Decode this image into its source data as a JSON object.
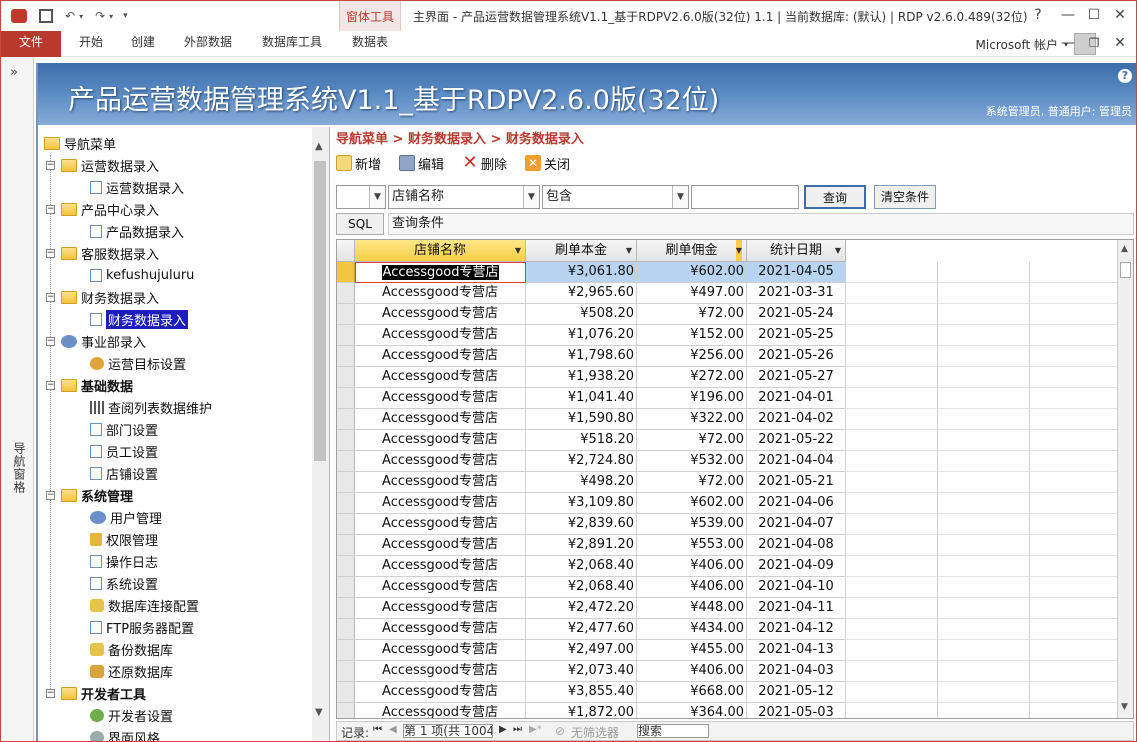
{
  "window": {
    "title": "主界面 - 产品运营数据管理系统V1.1_基于RDPV2.6.0版(32位) 1.1 | 当前数据库: (默认) | RDP v2.6.0.489(32位)",
    "context_tab_group": "窗体工具",
    "account": "Microsoft 帐户",
    "help_glyph": "?"
  },
  "ribbon": {
    "tabs": [
      "文件",
      "开始",
      "创建",
      "外部数据",
      "数据库工具",
      "数据表"
    ]
  },
  "nav_pane": {
    "label": "导航窗格",
    "collapse": "»"
  },
  "banner": {
    "title": "产品运营数据管理系统V1.1_基于RDPV2.6.0版(32位)",
    "user": "系统管理员, 普通用户: 管理员"
  },
  "tree": {
    "root": "导航菜单",
    "items": [
      "运营数据录入",
      "运营数据录入",
      "产品中心录入",
      "产品数据录入",
      "客服数据录入",
      "kefushujuluru",
      "财务数据录入",
      "财务数据录入",
      "事业部录入",
      "运营目标设置",
      "基础数据",
      "查阅列表数据维护",
      "部门设置",
      "员工设置",
      "店铺设置",
      "系统管理",
      "用户管理",
      "权限管理",
      "操作日志",
      "系统设置",
      "数据库连接配置",
      "FTP服务器配置",
      "备份数据库",
      "还原数据库",
      "开发者工具",
      "开发者设置",
      "界面风格"
    ]
  },
  "breadcrumb": "导航菜单 > 财务数据录入 > 财务数据录入",
  "toolbar": {
    "new": "新增",
    "edit": "编辑",
    "delete": "删除",
    "close": "关闭"
  },
  "filter": {
    "field": "店铺名称",
    "operator": "包含",
    "value": "",
    "query": "查询",
    "clear": "清空条件",
    "sql_label": "SQL",
    "sql_caption": "查询条件"
  },
  "table": {
    "columns": [
      "店铺名称",
      "刷单本金",
      "刷单佣金",
      "统计日期"
    ],
    "rows": [
      [
        "Accessgood专营店",
        "¥3,061.80",
        "¥602.00",
        "2021-04-05"
      ],
      [
        "Accessgood专营店",
        "¥2,965.60",
        "¥497.00",
        "2021-03-31"
      ],
      [
        "Accessgood专营店",
        "¥508.20",
        "¥72.00",
        "2021-05-24"
      ],
      [
        "Accessgood专营店",
        "¥1,076.20",
        "¥152.00",
        "2021-05-25"
      ],
      [
        "Accessgood专营店",
        "¥1,798.60",
        "¥256.00",
        "2021-05-26"
      ],
      [
        "Accessgood专营店",
        "¥1,938.20",
        "¥272.00",
        "2021-05-27"
      ],
      [
        "Accessgood专营店",
        "¥1,041.40",
        "¥196.00",
        "2021-04-01"
      ],
      [
        "Accessgood专营店",
        "¥1,590.80",
        "¥322.00",
        "2021-04-02"
      ],
      [
        "Accessgood专营店",
        "¥518.20",
        "¥72.00",
        "2021-05-22"
      ],
      [
        "Accessgood专营店",
        "¥2,724.80",
        "¥532.00",
        "2021-04-04"
      ],
      [
        "Accessgood专营店",
        "¥498.20",
        "¥72.00",
        "2021-05-21"
      ],
      [
        "Accessgood专营店",
        "¥3,109.80",
        "¥602.00",
        "2021-04-06"
      ],
      [
        "Accessgood专营店",
        "¥2,839.60",
        "¥539.00",
        "2021-04-07"
      ],
      [
        "Accessgood专营店",
        "¥2,891.20",
        "¥553.00",
        "2021-04-08"
      ],
      [
        "Accessgood专营店",
        "¥2,068.40",
        "¥406.00",
        "2021-04-09"
      ],
      [
        "Accessgood专营店",
        "¥2,068.40",
        "¥406.00",
        "2021-04-10"
      ],
      [
        "Accessgood专营店",
        "¥2,472.20",
        "¥448.00",
        "2021-04-11"
      ],
      [
        "Accessgood专营店",
        "¥2,477.60",
        "¥434.00",
        "2021-04-12"
      ],
      [
        "Accessgood专营店",
        "¥2,497.00",
        "¥455.00",
        "2021-04-13"
      ],
      [
        "Accessgood专营店",
        "¥2,073.40",
        "¥406.00",
        "2021-04-03"
      ],
      [
        "Accessgood专营店",
        "¥3,855.40",
        "¥668.00",
        "2021-05-12"
      ],
      [
        "Accessgood专营店",
        "¥1,872.00",
        "¥364.00",
        "2021-05-03"
      ]
    ]
  },
  "record_nav": {
    "label": "记录:",
    "position": "第 1 项(共 1004",
    "filter_state": "无筛选器",
    "search": "搜索"
  }
}
